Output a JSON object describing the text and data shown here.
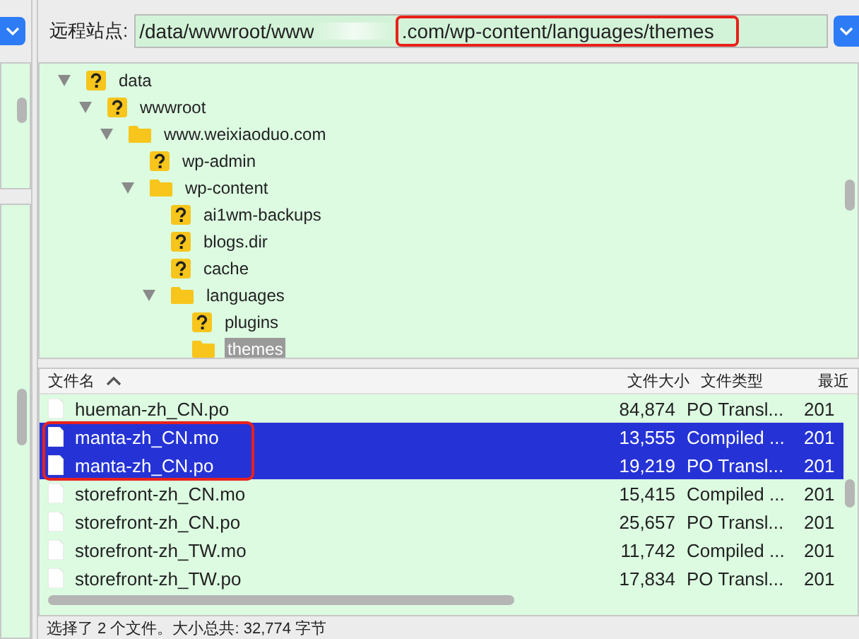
{
  "address": {
    "label": "远程站点:",
    "path_start": "/data/wwwroot/www",
    "path_end": ".com/wp-content/languages/themes",
    "highlighted": true
  },
  "tree": [
    {
      "name": "data",
      "kind": "unknown",
      "expanded": true,
      "selected": false,
      "children": [
        {
          "name": "wwwroot",
          "kind": "unknown",
          "expanded": true,
          "selected": false,
          "children": [
            {
              "name": "www.weixiaoduo.com",
              "kind": "folder",
              "expanded": true,
              "selected": false,
              "children": [
                {
                  "name": "wp-admin",
                  "kind": "unknown",
                  "expanded": false,
                  "selected": false
                },
                {
                  "name": "wp-content",
                  "kind": "folder",
                  "expanded": true,
                  "selected": false,
                  "children": [
                    {
                      "name": "ai1wm-backups",
                      "kind": "unknown",
                      "expanded": false,
                      "selected": false
                    },
                    {
                      "name": "blogs.dir",
                      "kind": "unknown",
                      "expanded": false,
                      "selected": false
                    },
                    {
                      "name": "cache",
                      "kind": "unknown",
                      "expanded": false,
                      "selected": false
                    },
                    {
                      "name": "languages",
                      "kind": "folder",
                      "expanded": true,
                      "selected": false,
                      "children": [
                        {
                          "name": "plugins",
                          "kind": "unknown",
                          "expanded": false,
                          "selected": false
                        },
                        {
                          "name": "themes",
                          "kind": "folder",
                          "expanded": false,
                          "selected": true
                        }
                      ]
                    }
                  ]
                }
              ]
            }
          ]
        }
      ]
    }
  ],
  "files": {
    "columns": [
      "文件名",
      "文件大小",
      "文件类型",
      "最近"
    ],
    "sort_ascending": true,
    "highlight_selected": true,
    "rows": [
      {
        "name": "hueman-zh_CN.po",
        "size": "84,874",
        "type": "PO Transl...",
        "column_4": "201",
        "selected": false
      },
      {
        "name": "manta-zh_CN.mo",
        "size": "13,555",
        "type": "Compiled ...",
        "column_4": "201",
        "selected": true
      },
      {
        "name": "manta-zh_CN.po",
        "size": "19,219",
        "type": "PO Transl...",
        "column_4": "201",
        "selected": true
      },
      {
        "name": "storefront-zh_CN.mo",
        "size": "15,415",
        "type": "Compiled ...",
        "column_4": "201",
        "selected": false
      },
      {
        "name": "storefront-zh_CN.po",
        "size": "25,657",
        "type": "PO Transl...",
        "column_4": "201",
        "selected": false
      },
      {
        "name": "storefront-zh_TW.mo",
        "size": "11,742",
        "type": "Compiled ...",
        "column_4": "201",
        "selected": false
      },
      {
        "name": "storefront-zh_TW.po",
        "size": "17,834",
        "type": "PO Transl...",
        "column_4": "201",
        "selected": false
      }
    ]
  },
  "status_bar": "选择了 2 个文件。大小总共: 32,774 字节"
}
